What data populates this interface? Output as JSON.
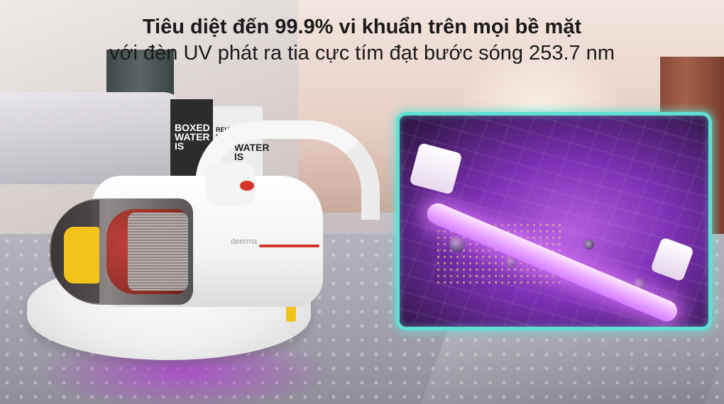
{
  "headline": {
    "line1": "Tiêu diệt đến 99.9% vi khuẩn trên mọi bề mặt",
    "line2": "với đèn UV phát ra tia cực tím đạt bước sóng 253.7 nm"
  },
  "background": {
    "carton_left_text": "BOXED WATER IS",
    "carton_right_text": "WATER IS",
    "carton_right_small": "REUSE YOUR"
  },
  "product": {
    "brand": "deerma"
  },
  "colors": {
    "accent_red": "#d8352a",
    "uv_purple": "#b45ee0",
    "frame_teal": "#5fe0d4",
    "sticker_yellow": "#f2c41b"
  }
}
